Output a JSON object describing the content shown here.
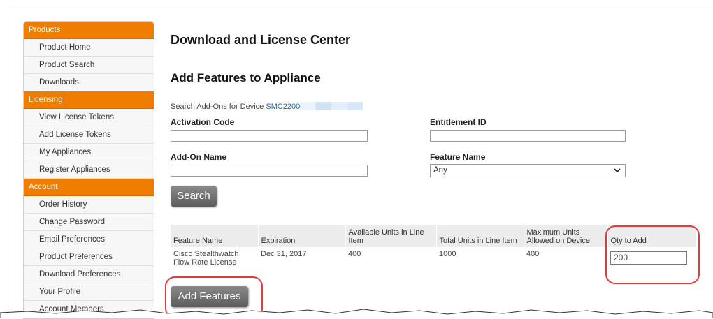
{
  "page": {
    "title": "Download and License Center",
    "subtitle": "Add Features to Appliance",
    "search_prefix": "Search Add-Ons for Device",
    "device_link": "SMC2200"
  },
  "sidebar": {
    "sections": [
      {
        "title": "Products",
        "items": [
          "Product Home",
          "Product Search",
          "Downloads"
        ]
      },
      {
        "title": "Licensing",
        "items": [
          "View License Tokens",
          "Add License Tokens",
          "My Appliances",
          "Register Appliances"
        ]
      },
      {
        "title": "Account",
        "items": [
          "Order History",
          "Change Password",
          "Email Preferences",
          "Product Preferences",
          "Download Preferences",
          "Your Profile",
          "Account Members"
        ]
      }
    ]
  },
  "form": {
    "activation_code_label": "Activation Code",
    "activation_code_value": "",
    "entitlement_id_label": "Entitlement ID",
    "entitlement_id_value": "",
    "addon_name_label": "Add-On Name",
    "addon_name_value": "",
    "feature_name_label": "Feature Name",
    "feature_name_value": "Any",
    "search_button": "Search"
  },
  "table": {
    "headers": [
      "Feature Name",
      "Expiration",
      "Available Units in Line Item",
      "Total Units in Line Item",
      "Maximum Units Allowed on Device",
      "Qty to Add"
    ],
    "rows": [
      {
        "feature_name": "Cisco Stealthwatch Flow Rate License",
        "expiration": "Dec 31, 2017",
        "available": "400",
        "total": "1000",
        "maximum": "400",
        "qty": "200"
      }
    ]
  },
  "actions": {
    "add_features_button": "Add Features"
  },
  "colors": {
    "sidebar_header": "#ef7d00",
    "link": "#1a66b5",
    "callout": "#e0393e"
  }
}
